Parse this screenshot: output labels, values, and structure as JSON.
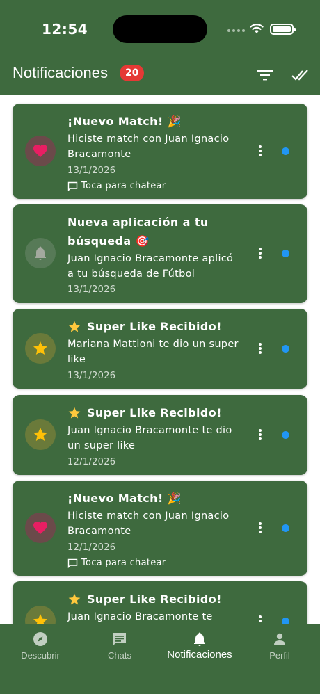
{
  "status_bar": {
    "time": "12:54"
  },
  "header": {
    "title": "Notificaciones",
    "unread_count": "20"
  },
  "colors": {
    "primary": "#3E6A3E",
    "badge": "#E53935",
    "unread_dot": "#2196F3",
    "heart": "#E91E63",
    "star": "#FFC107"
  },
  "notifications": [
    {
      "icon": "heart-icon",
      "title": "¡Nuevo Match! 🎉",
      "body": "Hiciste match con Juan Ignacio Bracamonte",
      "date": "13/1/2026",
      "hint": "Toca para chatear"
    },
    {
      "icon": "bell-icon",
      "title": "Nueva aplicación a tu búsqueda 🎯",
      "body": "Juan Ignacio Bracamonte aplicó a tu búsqueda de Fútbol",
      "date": "13/1/2026"
    },
    {
      "icon": "star-icon",
      "title": "Super Like Recibido!",
      "body": "Mariana Mattioni te dio un super like",
      "date": "13/1/2026"
    },
    {
      "icon": "star-icon",
      "title": "Super Like Recibido!",
      "body": "Juan Ignacio Bracamonte te dio un super like",
      "date": "12/1/2026"
    },
    {
      "icon": "heart-icon",
      "title": "¡Nuevo Match! 🎉",
      "body": "Hiciste match con Juan Ignacio Bracamonte",
      "date": "12/1/2026",
      "hint": "Toca para chatear"
    },
    {
      "icon": "star-icon",
      "title": "Super Like Recibido!",
      "body": "Juan Ignacio Bracamonte te"
    }
  ],
  "tabs": [
    {
      "label": "Descubrir",
      "icon": "compass-icon"
    },
    {
      "label": "Chats",
      "icon": "chat-icon"
    },
    {
      "label": "Notificaciones",
      "icon": "bell-icon",
      "active": true
    },
    {
      "label": "Perfil",
      "icon": "person-icon"
    }
  ]
}
